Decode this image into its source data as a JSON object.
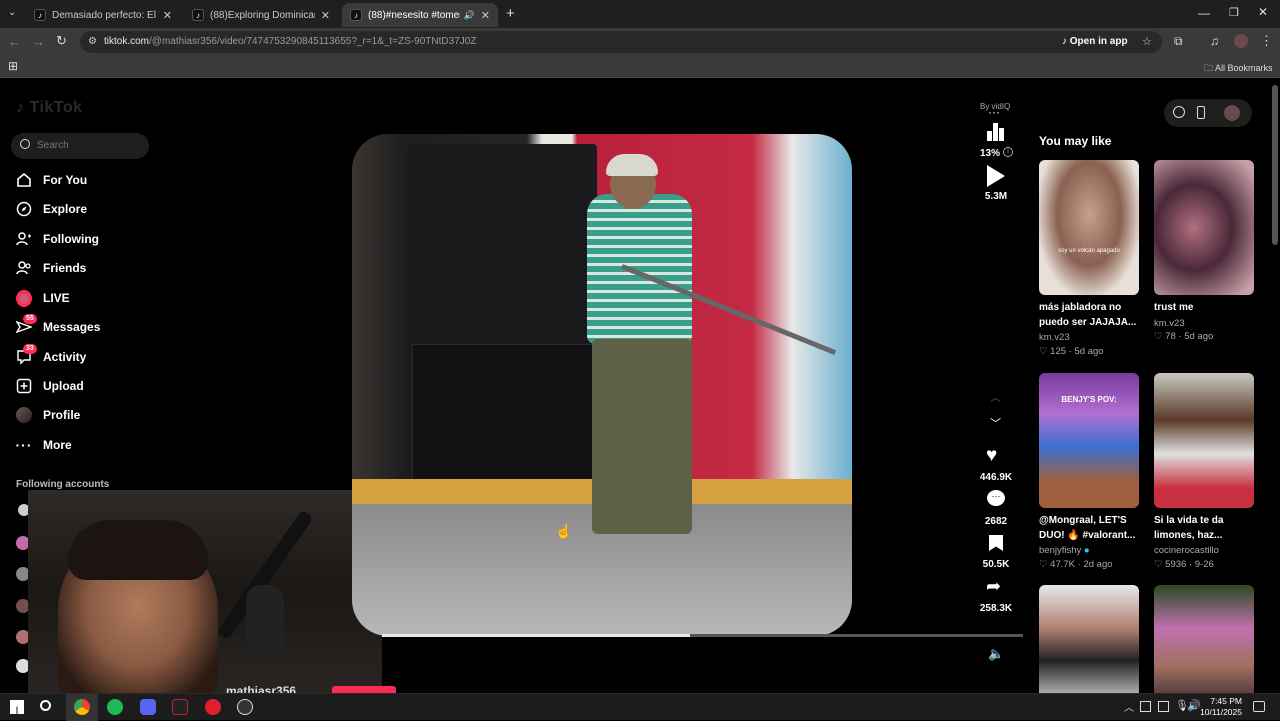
{
  "browser": {
    "tabs": [
      {
        "title": "Demasiado perfecto: El Lexus LF",
        "active": false
      },
      {
        "title": "(88)Exploring Dominican Cultur",
        "active": false
      },
      {
        "title": "(88)#nesesito #tomenyogur",
        "active": true
      }
    ],
    "url_domain": "tiktok.com",
    "url_path": "/@mathiasr356/video/7474753290845113655?_r=1&_t=ZS-90TNtD37J0Z",
    "open_in_app": "Open in app",
    "all_bookmarks": "All Bookmarks"
  },
  "sidebar": {
    "logo": "TikTok",
    "search_placeholder": "Search",
    "items": [
      {
        "label": "For You",
        "icon": "home-icon",
        "badge": ""
      },
      {
        "label": "Explore",
        "icon": "compass-icon",
        "badge": ""
      },
      {
        "label": "Following",
        "icon": "following-icon",
        "badge": ""
      },
      {
        "label": "Friends",
        "icon": "friends-icon",
        "badge": ""
      },
      {
        "label": "LIVE",
        "icon": "live-icon",
        "badge": ""
      },
      {
        "label": "Messages",
        "icon": "messages-icon",
        "badge": "55"
      },
      {
        "label": "Activity",
        "icon": "activity-icon",
        "badge": "33"
      },
      {
        "label": "Upload",
        "icon": "upload-icon",
        "badge": ""
      },
      {
        "label": "Profile",
        "icon": "avatar",
        "badge": ""
      },
      {
        "label": "More",
        "icon": "more-icon",
        "badge": ""
      }
    ],
    "following_accounts": "Following accounts"
  },
  "video": {
    "author_partial": "mathiasr356",
    "progress": 0.48,
    "vidiq_label": "By vidIQ",
    "vidiq_percent": "13%",
    "views": "5.3M",
    "likes": "446.9K",
    "comments": "2682",
    "saves": "50.5K",
    "shares": "258.3K"
  },
  "recommendations": {
    "heading": "You may like",
    "cards": [
      {
        "title": "más jabladora no puedo ser JAJAJA...",
        "author": "km.v23",
        "likes": "125",
        "age": "5d ago",
        "overlay": "soy un volcán apagado",
        "verified": false
      },
      {
        "title": "trust me",
        "author": "km.v23",
        "likes": "78",
        "age": "5d ago",
        "overlay": "",
        "verified": false
      },
      {
        "title": "@Mongraal, LET'S DUO! 🔥 #valorant...",
        "author": "benjyfishy",
        "likes": "47.7K",
        "age": "2d ago",
        "overlay": "BENJY'S POV:",
        "verified": true
      },
      {
        "title": "Si la vida te da limones, haz...",
        "author": "cocinerocastillo",
        "likes": "5936",
        "age": "9-26",
        "overlay": "",
        "verified": false
      },
      {
        "title": "",
        "author": "",
        "likes": "",
        "age": "",
        "overlay": "",
        "verified": false
      },
      {
        "title": "",
        "author": "",
        "likes": "",
        "age": "",
        "overlay": "",
        "verified": false
      }
    ]
  },
  "taskbar": {
    "time": "7:45 PM",
    "date": "10/11/2025"
  }
}
